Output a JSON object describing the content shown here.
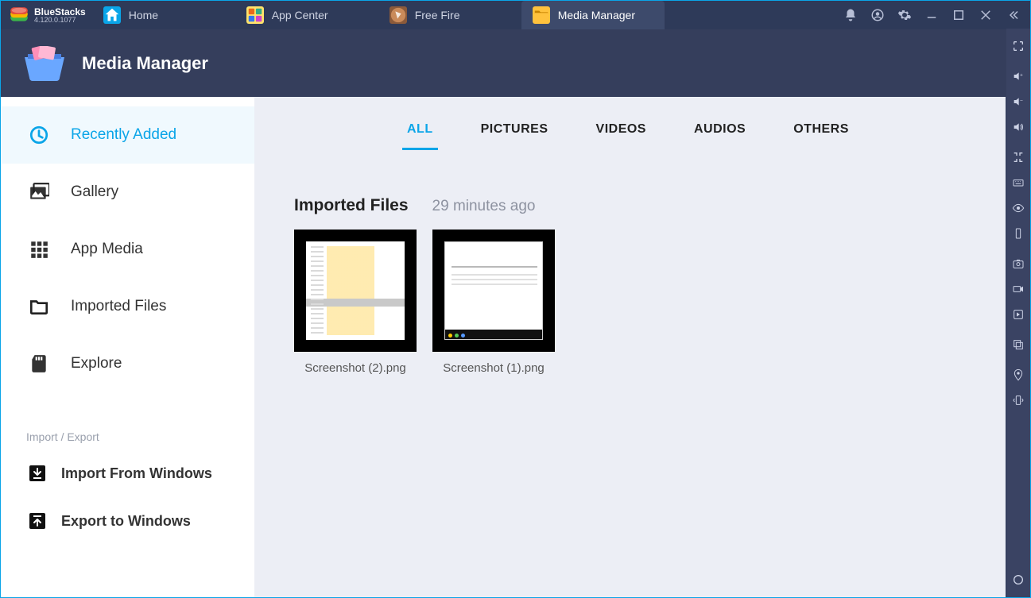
{
  "brand": {
    "name": "BlueStacks",
    "version": "4.120.0.1077"
  },
  "tabs": [
    {
      "label": "Home"
    },
    {
      "label": "App Center"
    },
    {
      "label": "Free Fire"
    },
    {
      "label": "Media Manager"
    }
  ],
  "header": {
    "title": "Media Manager"
  },
  "sidebar": {
    "items": [
      {
        "label": "Recently Added"
      },
      {
        "label": "Gallery"
      },
      {
        "label": "App Media"
      },
      {
        "label": "Imported Files"
      },
      {
        "label": "Explore"
      }
    ],
    "section_label": "Import / Export",
    "import_label": "Import From Windows",
    "export_label": "Export to Windows"
  },
  "filters": {
    "all": "ALL",
    "pictures": "PICTURES",
    "videos": "VIDEOS",
    "audios": "AUDIOS",
    "others": "OTHERS"
  },
  "section": {
    "title": "Imported Files",
    "timestamp": "29 minutes ago",
    "files": [
      {
        "name": "Screenshot (2).png"
      },
      {
        "name": "Screenshot (1).png"
      }
    ]
  }
}
